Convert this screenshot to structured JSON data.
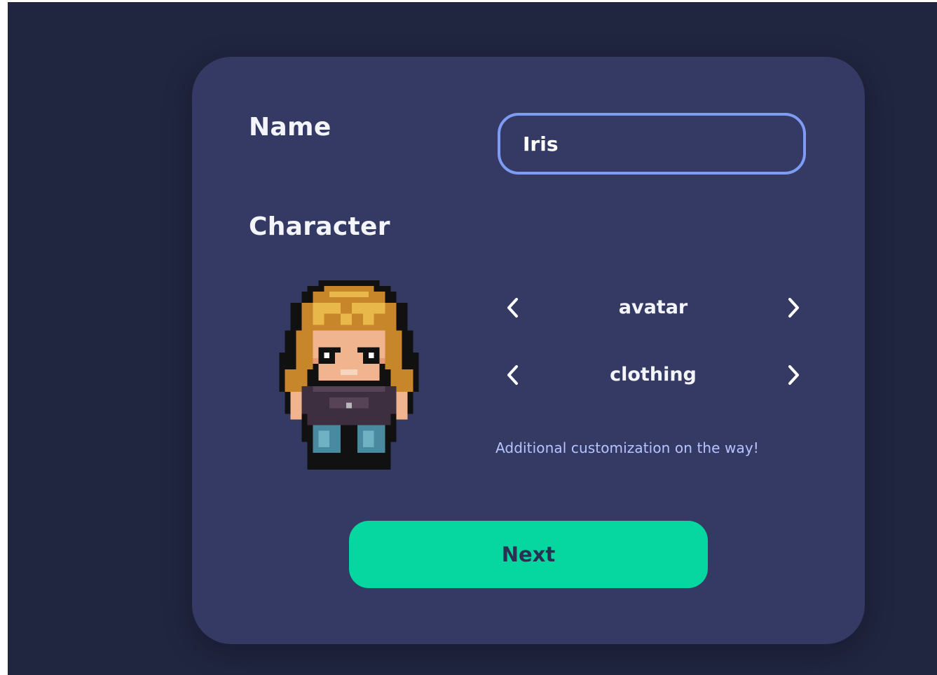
{
  "form": {
    "name_label": "Name",
    "name_value": "Iris",
    "character_label": "Character",
    "avatar_selector": {
      "value": "avatar",
      "prev_icon": "chevron-left-icon",
      "next_icon": "chevron-right-icon"
    },
    "clothing_selector": {
      "value": "clothing",
      "prev_icon": "chevron-left-icon",
      "next_icon": "chevron-right-icon"
    },
    "hint": "Additional customization on the way!",
    "next_label": "Next"
  },
  "colors": {
    "page_background": "#212640",
    "card_background": "#343a63",
    "input_border": "#7f9cf5",
    "accent": "#06d6a0",
    "hint_text": "#b7c4ff"
  }
}
